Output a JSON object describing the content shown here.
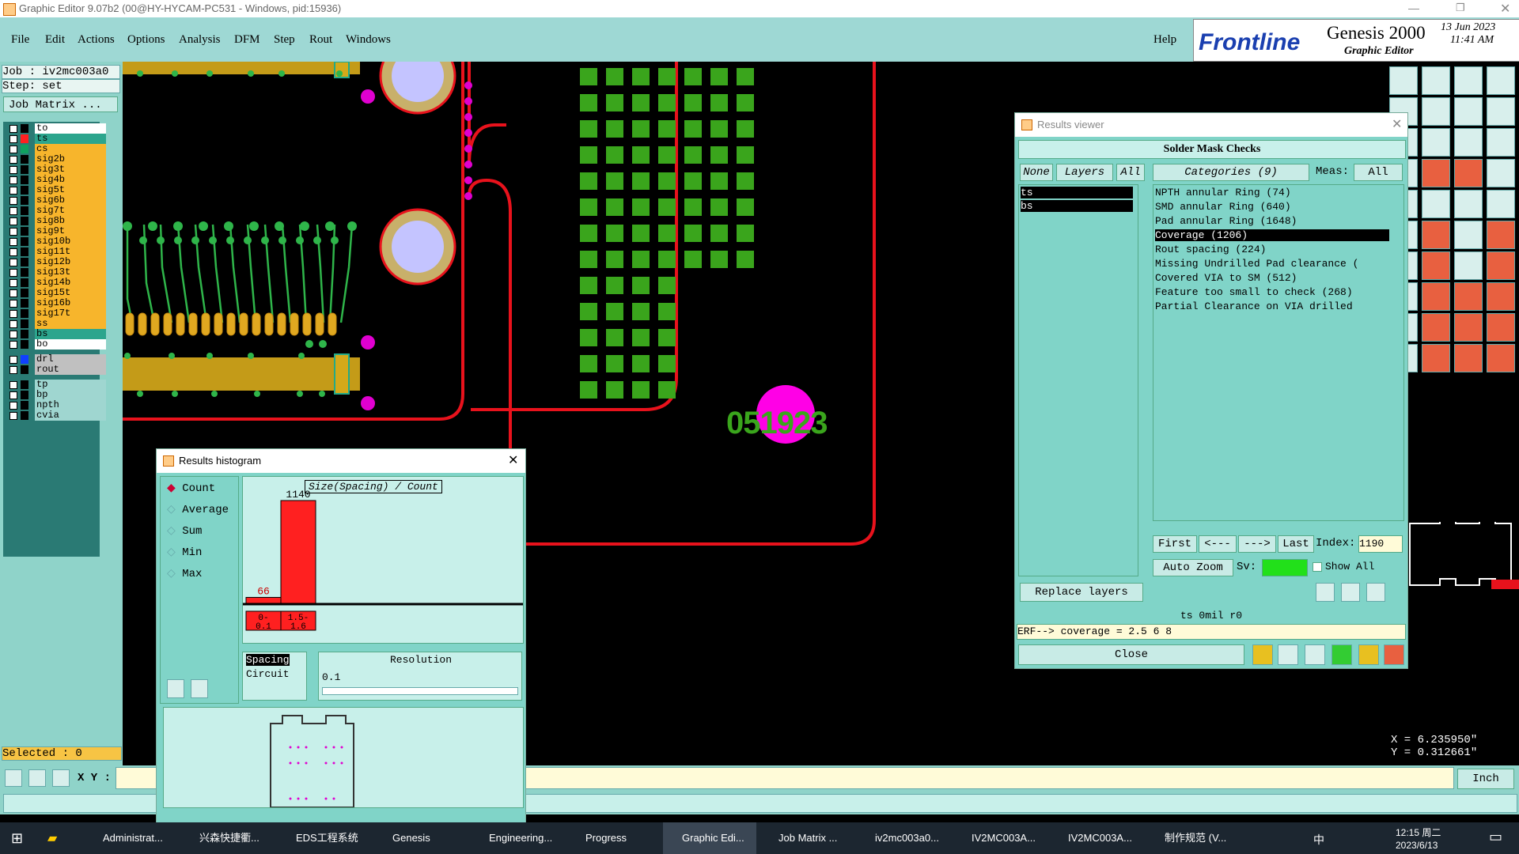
{
  "window": {
    "title": "Graphic Editor 9.07b2 (00@HY-HYCAM-PC531 - Windows, pid:15936)"
  },
  "menu": [
    "File",
    "Edit",
    "Actions",
    "Options",
    "Analysis",
    "DFM",
    "Step",
    "Rout",
    "Windows"
  ],
  "help_label": "Help",
  "brand": {
    "logo": "Frontline",
    "product": "Genesis 2000",
    "subtitle": "Graphic Editor",
    "date": "13 Jun 2023",
    "time": "11:41 AM"
  },
  "job": {
    "job_label": "Job : iv2mc003a0",
    "step_label": "Step: set",
    "matrix_button": "Job Matrix ..."
  },
  "layers_group1": [
    {
      "name": "to",
      "color": "#ffffff",
      "swatch": "#000000"
    },
    {
      "name": "ts",
      "color": "#2ca58d",
      "swatch": "#ff2020"
    },
    {
      "name": "cs",
      "color": "#f7b52c",
      "swatch": "#10a060"
    },
    {
      "name": "sig2b",
      "color": "#f7b52c",
      "swatch": "#000000"
    },
    {
      "name": "sig3t",
      "color": "#f7b52c",
      "swatch": "#000000"
    },
    {
      "name": "sig4b",
      "color": "#f7b52c",
      "swatch": "#000000"
    },
    {
      "name": "sig5t",
      "color": "#f7b52c",
      "swatch": "#000000"
    },
    {
      "name": "sig6b",
      "color": "#f7b52c",
      "swatch": "#000000"
    },
    {
      "name": "sig7t",
      "color": "#f7b52c",
      "swatch": "#000000"
    },
    {
      "name": "sig8b",
      "color": "#f7b52c",
      "swatch": "#000000"
    },
    {
      "name": "sig9t",
      "color": "#f7b52c",
      "swatch": "#000000"
    },
    {
      "name": "sig10b",
      "color": "#f7b52c",
      "swatch": "#000000"
    },
    {
      "name": "sig11t",
      "color": "#f7b52c",
      "swatch": "#000000"
    },
    {
      "name": "sig12b",
      "color": "#f7b52c",
      "swatch": "#000000"
    },
    {
      "name": "sig13t",
      "color": "#f7b52c",
      "swatch": "#000000"
    },
    {
      "name": "sig14b",
      "color": "#f7b52c",
      "swatch": "#000000"
    },
    {
      "name": "sig15t",
      "color": "#f7b52c",
      "swatch": "#000000"
    },
    {
      "name": "sig16b",
      "color": "#f7b52c",
      "swatch": "#000000"
    },
    {
      "name": "sig17t",
      "color": "#f7b52c",
      "swatch": "#000000"
    },
    {
      "name": "ss",
      "color": "#f7b52c",
      "swatch": "#000000"
    },
    {
      "name": "bs",
      "color": "#2ca58d",
      "swatch": "#000000"
    },
    {
      "name": "bo",
      "color": "#ffffff",
      "swatch": "#000000"
    }
  ],
  "layers_group2": [
    {
      "name": "drl",
      "color": "#c0c0c0",
      "swatch": "#1040ff"
    },
    {
      "name": "rout",
      "color": "#c0c0c0",
      "swatch": "#000000"
    }
  ],
  "layers_group3": [
    {
      "name": "tp",
      "color": "#9fd6d0",
      "swatch": "#000000"
    },
    {
      "name": "bp",
      "color": "#9fd6d0",
      "swatch": "#000000"
    },
    {
      "name": "npth",
      "color": "#9fd6d0",
      "swatch": "#000000"
    },
    {
      "name": "cvia",
      "color": "#9fd6d0",
      "swatch": "#000000"
    }
  ],
  "selected_label": "Selected : 0",
  "xy_label": "X Y :",
  "board_label": "051923",
  "histogram": {
    "title": "Results histogram",
    "modes": [
      "Count",
      "Average",
      "Sum",
      "Min",
      "Max"
    ],
    "chart_title": "Size(Spacing) / Count",
    "values": [
      66,
      1140
    ],
    "bins": [
      "0-\n0.1",
      "1.5-\n1.6"
    ],
    "list": [
      "Spacing",
      "Circuit"
    ],
    "resolution_label": "Resolution",
    "resolution_value": "0.1"
  },
  "results": {
    "title": "Results viewer",
    "header": "Solder Mask Checks",
    "btn_none": "None",
    "btn_layers": "Layers",
    "btn_all": "All",
    "categories_label": "Categories (9)",
    "meas_label": "Meas:",
    "meas_value": "All",
    "layers": [
      "ts",
      "bs"
    ],
    "categories": [
      "NPTH annular Ring (74)",
      "SMD annular Ring (640)",
      "Pad annular Ring (1648)",
      "Coverage (1206)",
      "Rout spacing (224)",
      "Missing Undrilled Pad clearance (",
      "Covered VIA to SM (512)",
      "Feature too small to check (268)",
      "Partial Clearance on VIA drilled"
    ],
    "nav": [
      "First",
      "<---",
      "--->",
      "Last"
    ],
    "index_label": "Index:",
    "index_value": "1190",
    "autozoom": "Auto Zoom",
    "sv_label": "Sv:",
    "show_all": "Show All",
    "replace_layers": "Replace layers",
    "status": "ts 0mil  r0",
    "erf": "ERF--> coverage = 2.5 6 8",
    "close": "Close"
  },
  "coords": {
    "x": "X = 6.235950\"",
    "y": "Y = 0.312661\""
  },
  "units": "Inch",
  "taskbar": {
    "items": [
      "Administrat...",
      "兴森快捷衢...",
      "EDS工程系统",
      "Genesis",
      "Engineering...",
      "Progress",
      "Graphic Edi...",
      "Job Matrix ...",
      "iv2mc003a0...",
      "IV2MC003A...",
      "IV2MC003A...",
      "制作规范 (V..."
    ],
    "tray_lang": "中",
    "time": "12:15 周二",
    "date": "2023/6/13"
  }
}
